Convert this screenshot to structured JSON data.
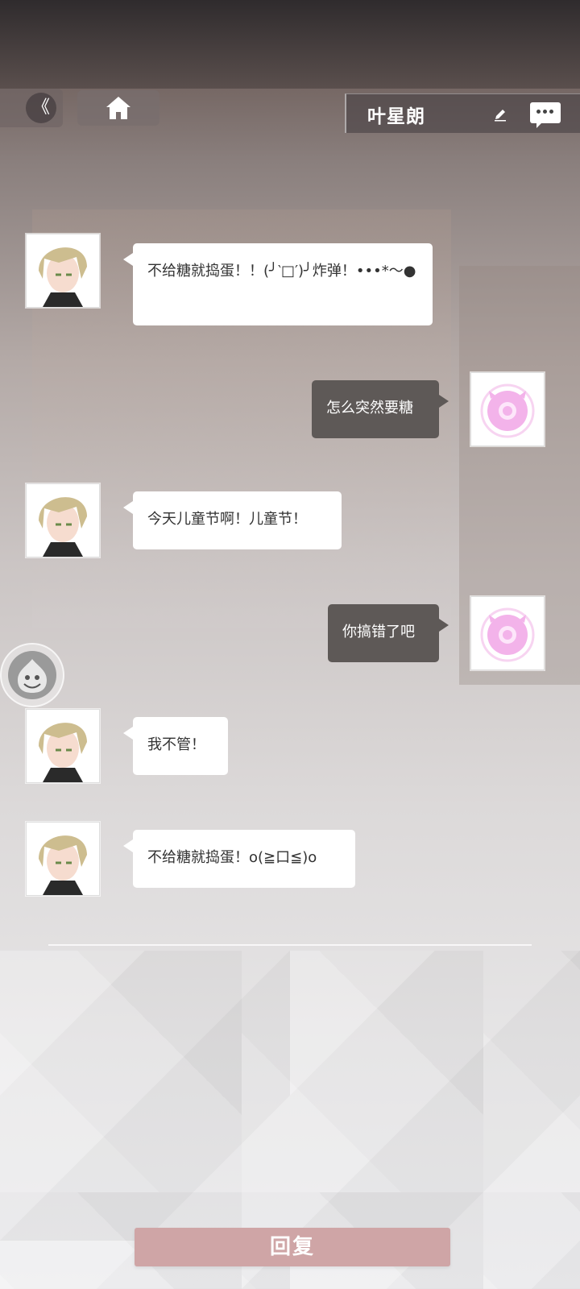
{
  "header": {
    "back_label": "《",
    "title": "叶星朗",
    "icons": [
      "double-chevron-left-icon",
      "home-icon",
      "pencil-icon",
      "more-chat-icon"
    ]
  },
  "messages": [
    {
      "side": "left",
      "text": "不给糖就捣蛋！！(╯‵□′)╯炸弹！•••*～●"
    },
    {
      "side": "right",
      "text": "怎么突然要糖"
    },
    {
      "side": "left",
      "text": "今天儿童节啊！儿童节！"
    },
    {
      "side": "right",
      "text": "你搞错了吧"
    },
    {
      "side": "left",
      "text": "我不管！"
    },
    {
      "side": "left",
      "text": "不给糖就捣蛋！o(≧口≦)o"
    }
  ],
  "footer": {
    "reply_label": "回复"
  },
  "colors": {
    "dark_bubble": "#5e5957",
    "reply_button": "#cfa5a6",
    "user_avatar_pink": "#f2a6e6"
  }
}
